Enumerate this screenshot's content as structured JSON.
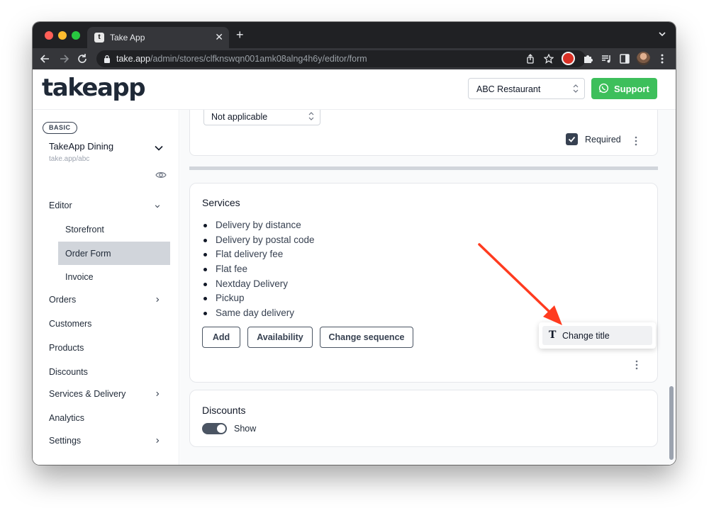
{
  "browser": {
    "tab_title": "Take App",
    "tab_favicon": "t",
    "url_host": "take.app",
    "url_path": "/admin/stores/clfknswqn001amk08alng4h6y/editor/form",
    "icons": [
      "back-icon",
      "forward-icon",
      "reload-icon",
      "lock-icon",
      "share-icon",
      "star-icon",
      "extension-icon",
      "puzzle-icon",
      "media-icon",
      "sidepanel-icon",
      "profile-avatar",
      "menu-icon"
    ]
  },
  "header": {
    "logo": "takeapp",
    "store_select": "ABC Restaurant",
    "support_label": "Support"
  },
  "sidebar": {
    "plan_badge": "BASIC",
    "store_name": "TakeApp Dining",
    "store_url": "take.app/abc",
    "items": {
      "editor": "Editor",
      "storefront": "Storefront",
      "order_form": "Order Form",
      "invoice": "Invoice",
      "orders": "Orders",
      "customers": "Customers",
      "products": "Products",
      "discounts": "Discounts",
      "services_delivery": "Services & Delivery",
      "analytics": "Analytics",
      "settings": "Settings"
    },
    "active_item": "Order Form"
  },
  "form_field": {
    "select_value": "Not applicable",
    "required_label": "Required",
    "required_checked": true
  },
  "services": {
    "title": "Services",
    "items": [
      "Delivery by distance",
      "Delivery by postal code",
      "Flat delivery fee",
      "Flat fee",
      "Nextday Delivery",
      "Pickup",
      "Same day delivery"
    ],
    "buttons": {
      "add": "Add",
      "availability": "Availability",
      "change_sequence": "Change sequence"
    },
    "menu": {
      "change_title": "Change title"
    }
  },
  "discounts": {
    "title": "Discounts",
    "show_label": "Show",
    "show_enabled": true
  },
  "colors": {
    "support_green": "#3dbf5b",
    "active_nav": "#d1d5db",
    "annotation_arrow": "#ff3b1f"
  }
}
